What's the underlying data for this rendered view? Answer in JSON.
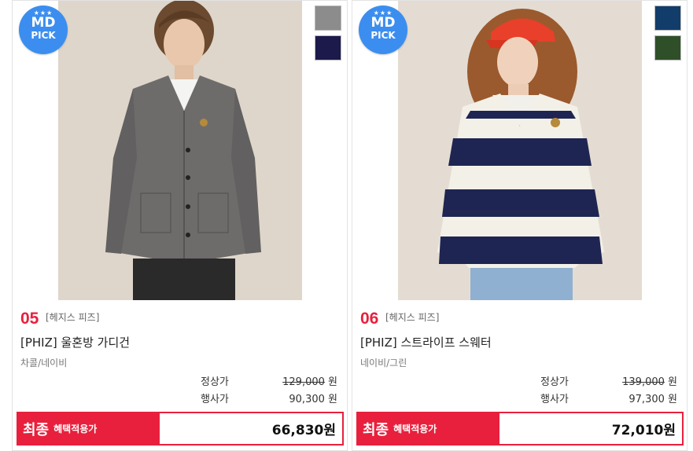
{
  "products": [
    {
      "badge": {
        "stars": "★★★",
        "top": "MD",
        "bottom": "PICK"
      },
      "swatches": [
        "#8c8c8c",
        "#1c1a4a"
      ],
      "rank": "05",
      "brand": "[헤지스 피즈]",
      "name": "[PHIZ] 울혼방 가디건",
      "colors": "차콜/네이비",
      "regular_label": "정상가",
      "regular_price": "129,000",
      "regular_unit": "원",
      "sale_label": "행사가",
      "sale_price": "90,300",
      "sale_unit": "원",
      "final_label_big": "최종",
      "final_label_small": "혜택적용가",
      "final_price": "66,830원"
    },
    {
      "badge": {
        "stars": "★★★",
        "top": "MD",
        "bottom": "PICK"
      },
      "swatches": [
        "#123d6b",
        "#2f4f29"
      ],
      "rank": "06",
      "brand": "[헤지스 피즈]",
      "name": "[PHIZ] 스트라이프 스웨터",
      "colors": "네이비/그린",
      "regular_label": "정상가",
      "regular_price": "139,000",
      "regular_unit": "원",
      "sale_label": "행사가",
      "sale_price": "97,300",
      "sale_unit": "원",
      "final_label_big": "최종",
      "final_label_small": "혜택적용가",
      "final_price": "72,010원"
    }
  ]
}
